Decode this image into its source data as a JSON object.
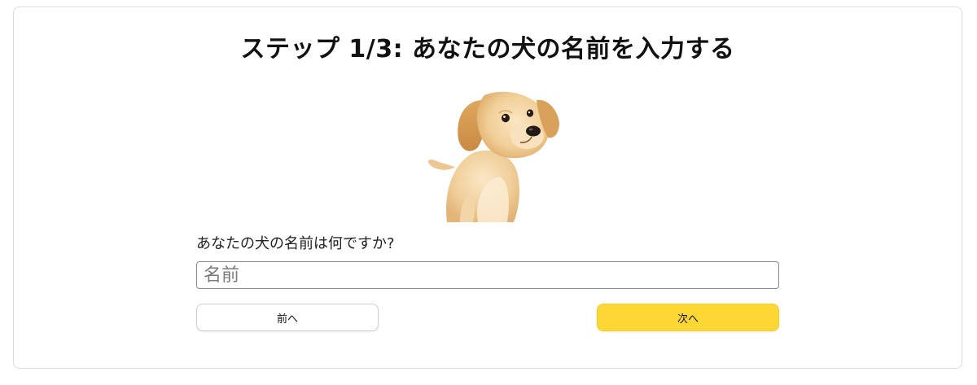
{
  "step": {
    "title": "ステップ 1/3: あなたの犬の名前を入力する"
  },
  "form": {
    "question": "あなたの犬の名前は何ですか?",
    "name_placeholder": "名前",
    "name_value": ""
  },
  "navigation": {
    "prev_label": "前へ",
    "next_label": "次へ"
  },
  "image": {
    "icon": "puppy-photo",
    "alt": "puppy"
  },
  "colors": {
    "next_button": "#fdd835",
    "card_border": "#dcdcdc",
    "fur_light": "#f1d3a3",
    "fur_dark": "#d9a463"
  }
}
